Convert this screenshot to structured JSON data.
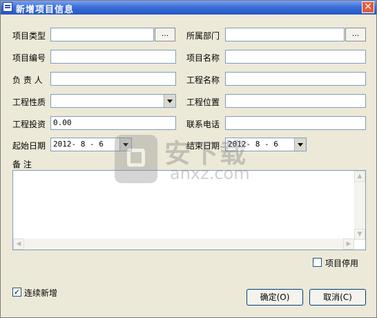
{
  "window": {
    "title": "新增项目信息",
    "close_label": "✕"
  },
  "form": {
    "project_type": {
      "label": "项目类型",
      "value": "",
      "browse": "..."
    },
    "department": {
      "label": "所属部门",
      "value": "",
      "browse": "..."
    },
    "project_code": {
      "label": "项目编号",
      "value": ""
    },
    "project_name": {
      "label": "项目名称",
      "value": ""
    },
    "manager": {
      "label": "负 责 人",
      "value": ""
    },
    "engineering_name": {
      "label": "工程名称",
      "value": ""
    },
    "engineering_nature": {
      "label": "工程性质",
      "value": ""
    },
    "engineering_location": {
      "label": "工程位置",
      "value": ""
    },
    "investment": {
      "label": "工程投资",
      "value": "0.00"
    },
    "phone": {
      "label": "联系电话",
      "value": ""
    },
    "start_date": {
      "label": "起始日期",
      "value": "2012- 8 - 6"
    },
    "end_date": {
      "label": "结束日期",
      "value": "2012- 8 - 6"
    },
    "remarks": {
      "label": "备 注",
      "value": ""
    }
  },
  "options": {
    "project_disabled": {
      "label": "项目停用",
      "checked": false
    },
    "continuous_add": {
      "label": "连续新增",
      "checked": true
    }
  },
  "buttons": {
    "ok": "确定(O)",
    "cancel": "取消(C)"
  },
  "watermark": {
    "cn": "安下载",
    "en": "anxz.com"
  }
}
